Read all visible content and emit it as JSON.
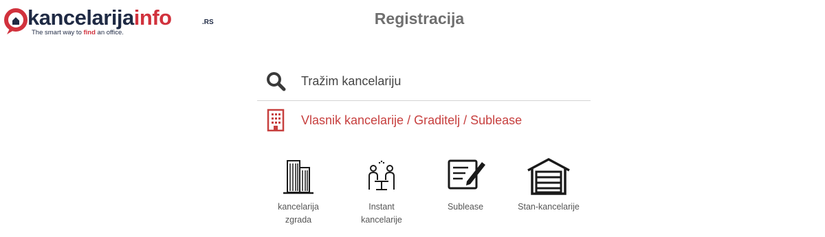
{
  "logo": {
    "word_part1": "kancelarija",
    "word_part2": "info",
    "suffix": ".RS",
    "tagline_pre": "The smart way to ",
    "tagline_em": "find",
    "tagline_post": " an office."
  },
  "page": {
    "title": "Registracija"
  },
  "options": [
    {
      "label": "Tražim kancelariju",
      "icon": "search-icon"
    },
    {
      "label": "Vlasnik kancelarije / Graditelj / Sublease",
      "icon": "building-icon"
    }
  ],
  "types": [
    {
      "label_line1": "kancelarija",
      "label_line2": "zgrada",
      "icon": "office-building-icon"
    },
    {
      "label_line1": "Instant",
      "label_line2": "kancelarije",
      "icon": "coworking-icon"
    },
    {
      "label_line1": "Sublease",
      "label_line2": "",
      "icon": "contract-sign-icon"
    },
    {
      "label_line1": "Stan-kancelarije",
      "label_line2": "",
      "icon": "garage-icon"
    }
  ],
  "colors": {
    "accent": "#c7403f",
    "brand_dark": "#1f2a44",
    "title_gray": "#6f6f6f"
  }
}
